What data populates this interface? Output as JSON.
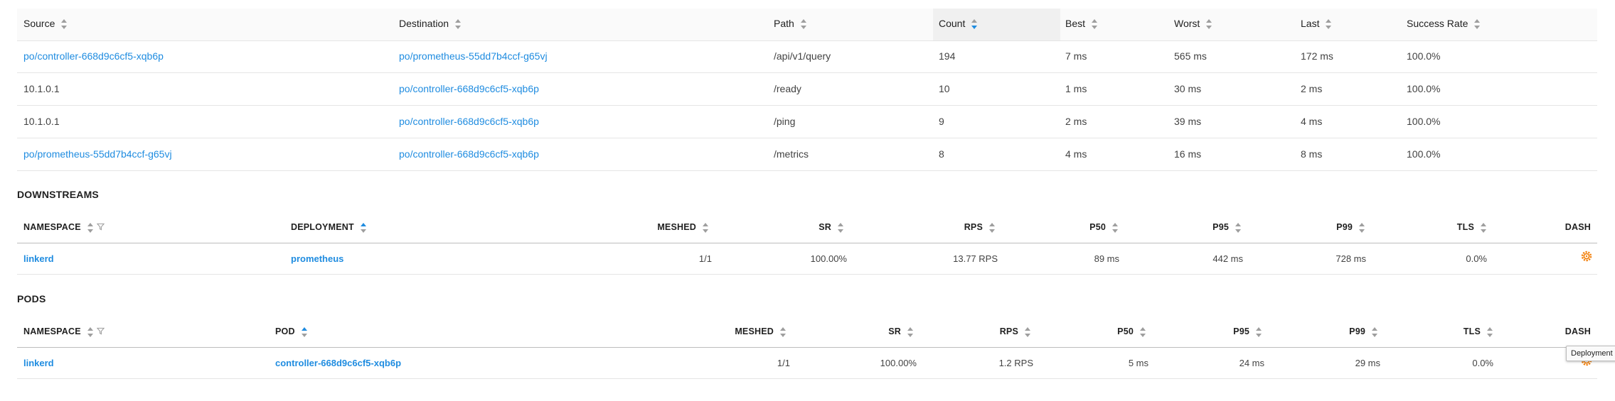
{
  "routes": {
    "columns": [
      "Source",
      "Destination",
      "Path",
      "Count",
      "Best",
      "Worst",
      "Last",
      "Success Rate"
    ],
    "rows": [
      {
        "source": "po/controller-668d9c6cf5-xqb6p",
        "destination": "po/prometheus-55dd7b4ccf-g65vj",
        "path": "/api/v1/query",
        "count": "194",
        "best": "7 ms",
        "worst": "565 ms",
        "last": "172 ms",
        "success_rate": "100.0%"
      },
      {
        "source": "10.1.0.1",
        "destination": "po/controller-668d9c6cf5-xqb6p",
        "path": "/ready",
        "count": "10",
        "best": "1 ms",
        "worst": "30 ms",
        "last": "2 ms",
        "success_rate": "100.0%"
      },
      {
        "source": "10.1.0.1",
        "destination": "po/controller-668d9c6cf5-xqb6p",
        "path": "/ping",
        "count": "9",
        "best": "2 ms",
        "worst": "39 ms",
        "last": "4 ms",
        "success_rate": "100.0%"
      },
      {
        "source": "po/prometheus-55dd7b4ccf-g65vj",
        "destination": "po/controller-668d9c6cf5-xqb6p",
        "path": "/metrics",
        "count": "8",
        "best": "4 ms",
        "worst": "16 ms",
        "last": "8 ms",
        "success_rate": "100.0%"
      }
    ]
  },
  "downstreams": {
    "title": "DOWNSTREAMS",
    "columns": {
      "namespace": "NAMESPACE",
      "deployment": "DEPLOYMENT",
      "meshed": "MESHED",
      "sr": "SR",
      "rps": "RPS",
      "p50": "P50",
      "p95": "P95",
      "p99": "P99",
      "tls": "TLS",
      "dash": "DASH"
    },
    "row": {
      "namespace": "linkerd",
      "deployment": "prometheus",
      "meshed": "1/1",
      "sr": "100.00%",
      "rps": "13.77 RPS",
      "p50": "89 ms",
      "p95": "442 ms",
      "p99": "728 ms",
      "tls": "0.0%"
    }
  },
  "pods": {
    "title": "PODS",
    "columns": {
      "namespace": "NAMESPACE",
      "pod": "POD",
      "meshed": "MESHED",
      "sr": "SR",
      "rps": "RPS",
      "p50": "P50",
      "p95": "P95",
      "p99": "P99",
      "tls": "TLS",
      "dash": "DASH"
    },
    "row": {
      "namespace": "linkerd",
      "pod": "controller-668d9c6cf5-xqb6p",
      "meshed": "1/1",
      "sr": "100.00%",
      "rps": "1.2 RPS",
      "p50": "5 ms",
      "p95": "24 ms",
      "p99": "29 ms",
      "tls": "0.0%"
    }
  },
  "tooltip": {
    "text": "Deployment"
  },
  "icons": {
    "sort": "sort-icon",
    "filter": "filter-icon",
    "grafana": "grafana-gear-icon"
  },
  "colors": {
    "link": "#1f8ce0",
    "grafana": "#f2800c",
    "active_sort": "#1f8ce0"
  }
}
